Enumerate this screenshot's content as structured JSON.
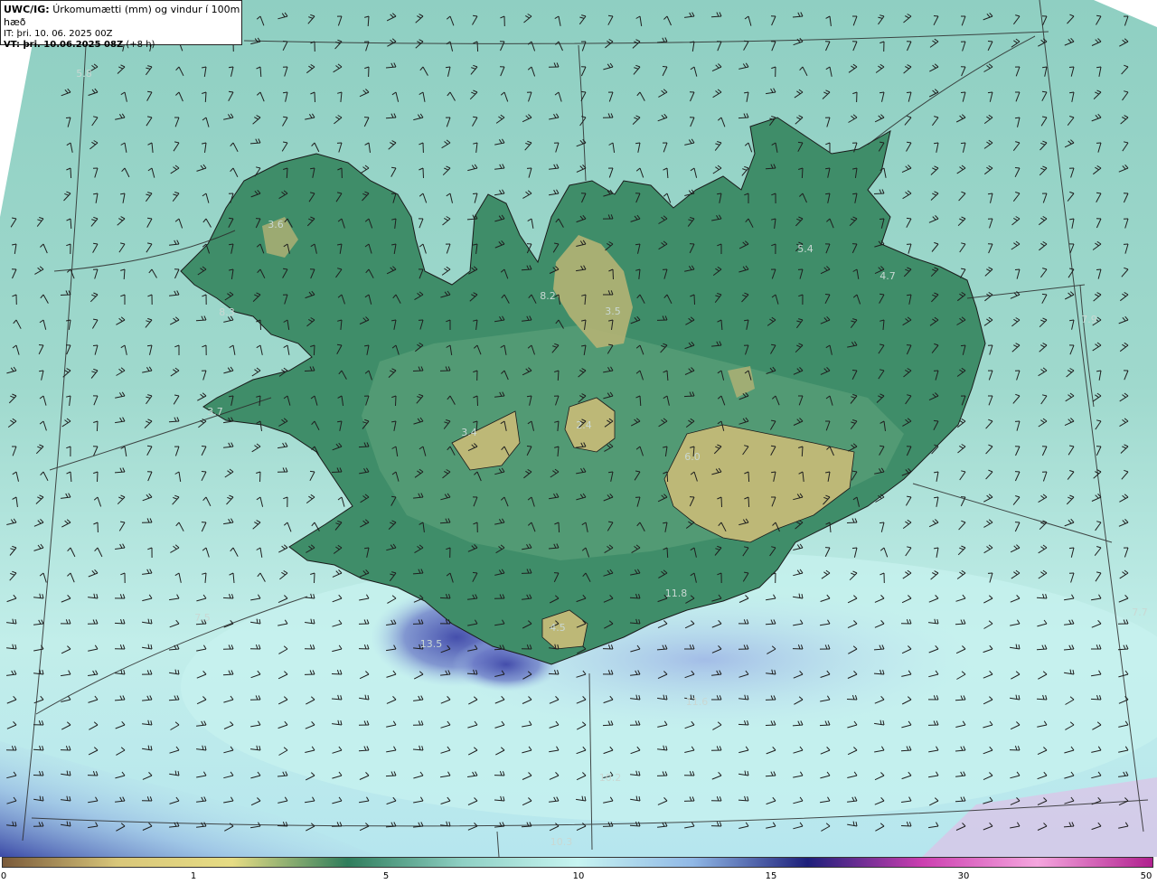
{
  "info": {
    "model": "UWC/IG:",
    "title": "Úrkomumætti (mm) og vindur í 100m hæð",
    "it_label": "IT:",
    "it_value": "þri. 10. 06. 2025 00Z",
    "vt_label": "VT: þri. 10.06.2025 08Z",
    "vt_offset": "(+8 h)"
  },
  "colors": {
    "land_low": "#3c8a66",
    "land_mid": "#5a9c73",
    "highland": "#b9b777",
    "sea": "#9ed8cc",
    "sea_light": "#c6f1ec",
    "heavy": "#5a63b8",
    "coast": "#1a1a1a"
  },
  "colorbar": {
    "ticks": [
      "0",
      "1",
      "5",
      "10",
      "15",
      "30",
      "50"
    ],
    "stops": [
      "#7a5a3a",
      "#d9c77a",
      "#e6dc84",
      "#2f7d5c",
      "#8fd0c4",
      "#c7f4f1",
      "#90b8e6",
      "#1d1f7a",
      "#cc3fb0",
      "#f5a6de",
      "#b0208e"
    ]
  },
  "values": [
    "5.8",
    "3.6",
    "8.3",
    "3.7",
    "3.4",
    "2.4",
    "8.2",
    "3.5",
    "5.4",
    "4.7",
    "7.9",
    "6.0",
    "11.8",
    "4.5",
    "13.5",
    "7.5",
    "11.6",
    "10.2",
    "10.3",
    "7.7"
  ]
}
